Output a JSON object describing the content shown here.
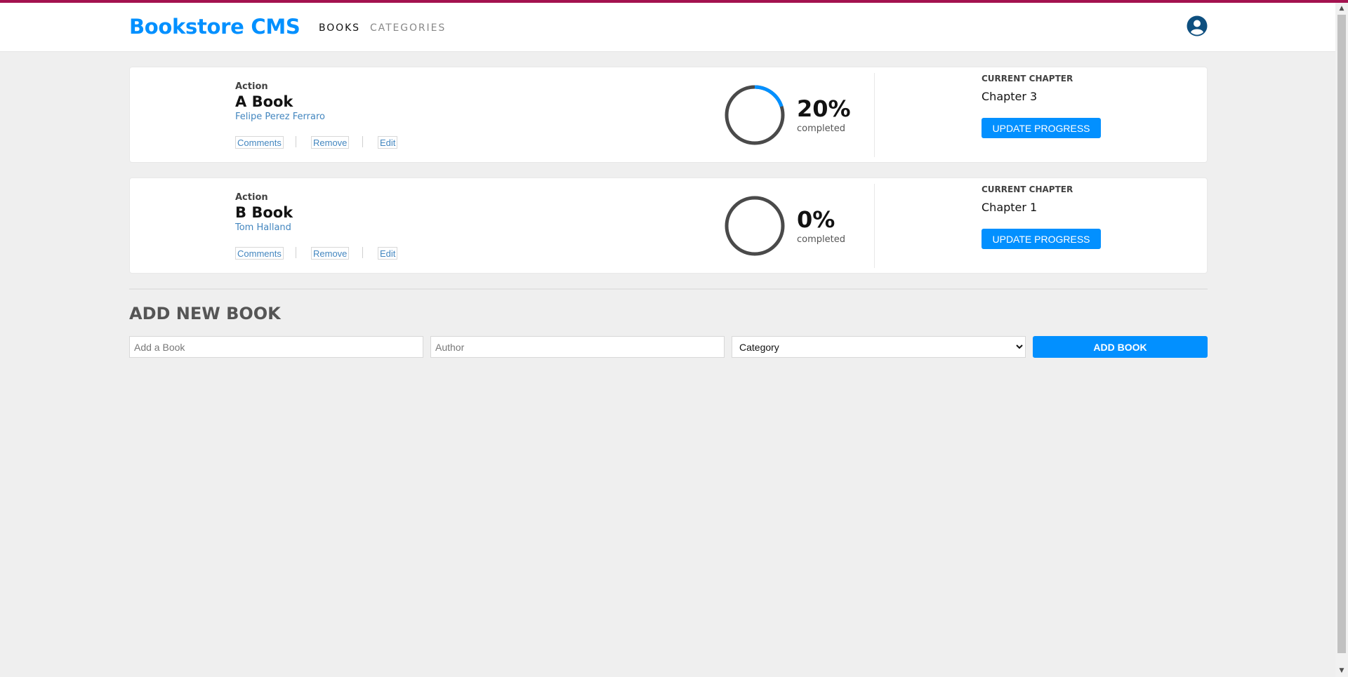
{
  "header": {
    "logo": "Bookstore CMS",
    "nav": {
      "books": "BOOKS",
      "categories": "CATEGORIES"
    },
    "avatar_icon": "user-avatar-icon"
  },
  "books": [
    {
      "genre": "Action",
      "title": "A Book",
      "author": "Felipe Perez Ferraro",
      "actions": {
        "comments": "Comments",
        "remove": "Remove",
        "edit": "Edit"
      },
      "progress_percent": 20,
      "progress_text": "20%",
      "completed_label": "completed",
      "current_chapter_label": "CURRENT CHAPTER",
      "current_chapter": "Chapter 3",
      "update_label": "UPDATE PROGRESS"
    },
    {
      "genre": "Action",
      "title": "B Book",
      "author": "Tom Halland",
      "actions": {
        "comments": "Comments",
        "remove": "Remove",
        "edit": "Edit"
      },
      "progress_percent": 0,
      "progress_text": "0%",
      "completed_label": "completed",
      "current_chapter_label": "CURRENT CHAPTER",
      "current_chapter": "Chapter 1",
      "update_label": "UPDATE PROGRESS"
    }
  ],
  "form": {
    "title": "ADD NEW BOOK",
    "title_placeholder": "Add a Book",
    "author_placeholder": "Author",
    "category_selected": "Category",
    "submit_label": "ADD BOOK"
  },
  "colors": {
    "accent": "#0290ff",
    "top_bar": "#a3124f",
    "ring_track": "#4a4a4a",
    "background": "#efefef"
  }
}
